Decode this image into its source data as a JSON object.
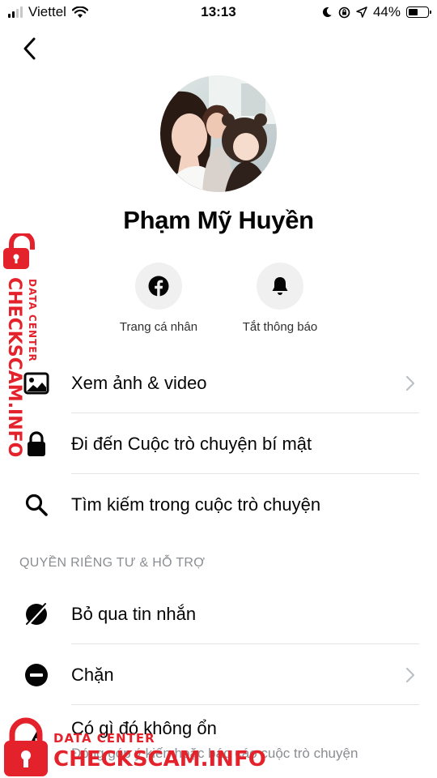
{
  "status_bar": {
    "carrier": "Viettel",
    "time": "13:13",
    "battery_percent": "44%",
    "battery_level": 0.44
  },
  "profile": {
    "name": "Phạm Mỹ Huyền"
  },
  "actions": [
    {
      "label": "Trang cá nhân",
      "icon": "facebook-icon"
    },
    {
      "label": "Tắt thông báo",
      "icon": "bell-icon"
    }
  ],
  "menu": [
    {
      "label": "Xem ảnh & video",
      "icon": "image-icon",
      "chevron": true
    },
    {
      "label": "Đi đến Cuộc trò chuyện bí mật",
      "icon": "lock-icon",
      "chevron": false
    },
    {
      "label": "Tìm kiếm trong cuộc trò chuyện",
      "icon": "search-icon",
      "chevron": false
    }
  ],
  "privacy_section": {
    "header": "QUYỀN RIÊNG TƯ & HỖ TRỢ",
    "items": [
      {
        "label": "Bỏ qua tin nhắn",
        "icon": "ignore-icon",
        "chevron": false
      },
      {
        "label": "Chặn",
        "icon": "block-icon",
        "chevron": true
      },
      {
        "label": "Có gì đó không ổn",
        "icon": "warning-icon",
        "sublabel": "Đóng góp ý kiến hoặc báo cáo cuộc trò chuyện"
      }
    ]
  },
  "watermark": {
    "brand": "CHECKSCAM.INFO",
    "tagline": "DATA CENTER"
  },
  "colors": {
    "watermark_red": "#e4222c",
    "icon_bg": "#f0f0f0",
    "secondary_text": "#8a8d91"
  }
}
